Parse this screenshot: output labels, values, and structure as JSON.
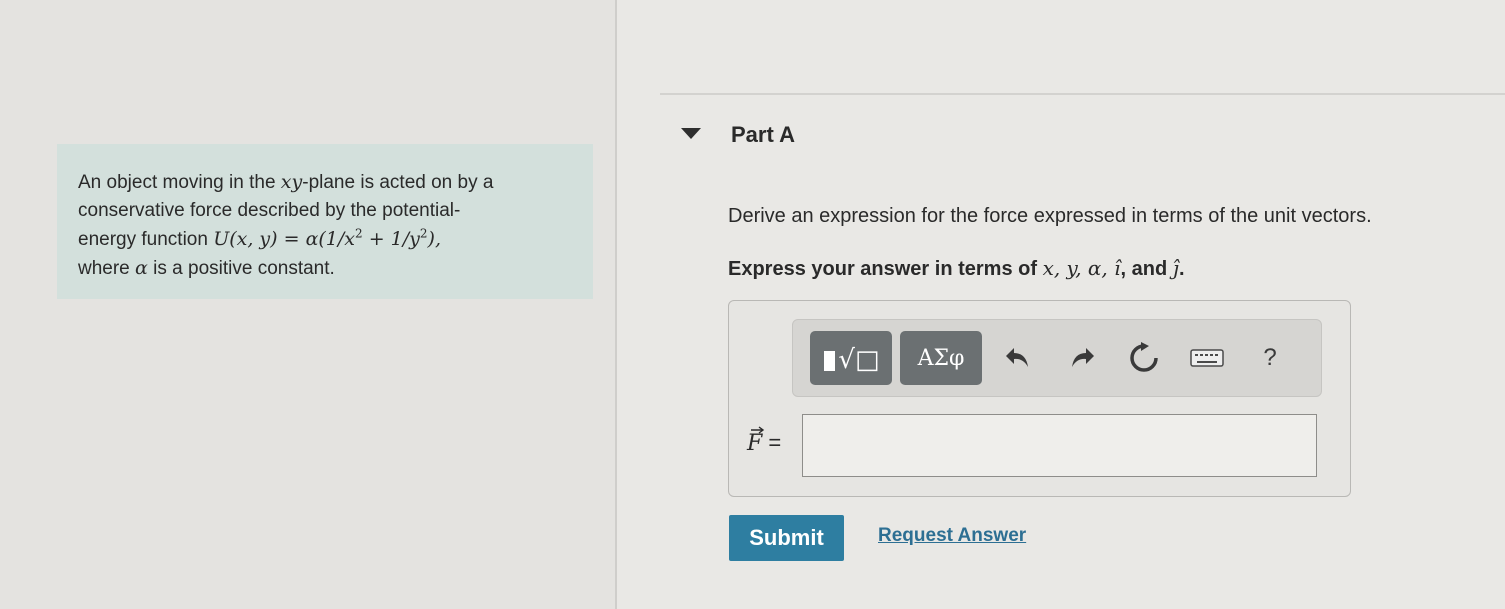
{
  "problem": {
    "line1_a": "An object moving in the ",
    "line1_math": "xy",
    "line1_b": "-plane is acted on by a",
    "line2": "conservative force described by the potential-",
    "line3_a": "energy function ",
    "line3_math_a": "U(x, y) = α(1/x",
    "sup1": "2",
    "line3_math_b": " + 1/y",
    "sup2": "2",
    "line3_math_c": "),",
    "line4_a": "where ",
    "line4_math": "α",
    "line4_b": " is a positive constant."
  },
  "part": {
    "title": "Part A"
  },
  "question": "Derive an expression for the force expressed in terms of the unit vectors.",
  "instruction": {
    "prefix": "Express your answer in terms of ",
    "vars": "x, y, α, î",
    "middle": ", and ",
    "last": "ĵ",
    "suffix": "."
  },
  "toolbar": {
    "templates_label": "√□",
    "greek_label": "ΑΣφ",
    "help_label": "?"
  },
  "answer": {
    "label": "F",
    "equals": " =",
    "value": ""
  },
  "actions": {
    "submit": "Submit",
    "request": "Request Answer"
  },
  "colors": {
    "accent": "#2e7ea1",
    "link": "#2d6f93",
    "problem_bg": "#d3e0dc",
    "tool_btn": "#6b7072"
  },
  "icons": [
    "caret-down-icon",
    "templates-icon",
    "undo-icon",
    "redo-icon",
    "reset-icon",
    "keyboard-icon",
    "help-icon"
  ]
}
